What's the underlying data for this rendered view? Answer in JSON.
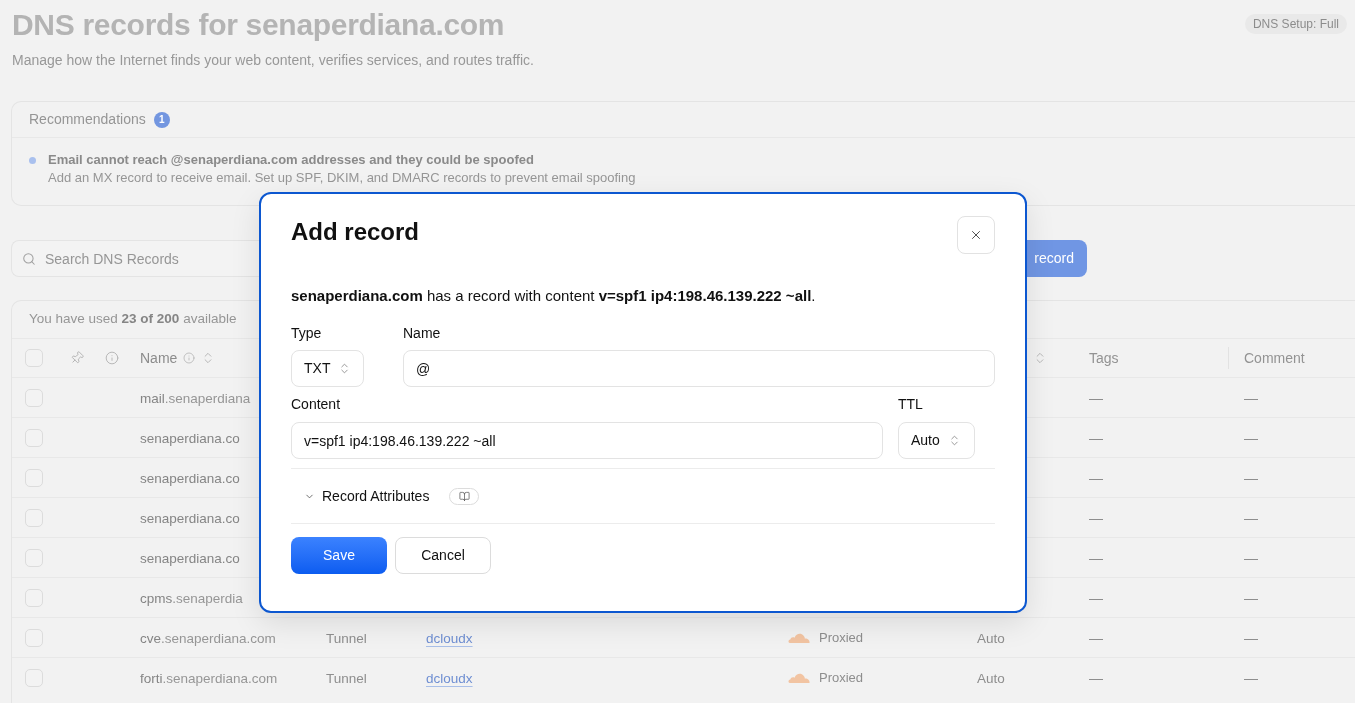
{
  "header": {
    "title": "DNS records for senaperdiana.com",
    "subtitle": "Manage how the Internet finds your web content, verifies services, and routes traffic.",
    "setup_badge": "DNS Setup: Full"
  },
  "recommendations": {
    "title": "Recommendations",
    "count": "1",
    "items": [
      {
        "title": "Email cannot reach @senaperdiana.com addresses and they could be spoofed",
        "description": "Add an MX record to receive email. Set up SPF, DKIM, and DMARC records to prevent email spoofing"
      }
    ]
  },
  "toolbar": {
    "search": {
      "placeholder": "Search DNS Records"
    },
    "add_button": "record"
  },
  "table": {
    "usage": "You have used **23 of 200** available",
    "select_all_checked": false,
    "columns": {
      "name": "Name",
      "tags": "Tags",
      "comment": "Comment"
    },
    "rows": [
      {
        "checked": false,
        "name": {
          "host": "mail",
          "zone": ".senaperdiana"
        },
        "tags": "—",
        "comment": "—"
      },
      {
        "checked": false,
        "name": {
          "host": "senaperdiana.co"
        },
        "tags": "—",
        "comment": "—"
      },
      {
        "checked": false,
        "name": {
          "host": "senaperdiana.co"
        },
        "tags": "—",
        "comment": "—"
      },
      {
        "checked": false,
        "name": {
          "host": "senaperdiana.co"
        },
        "tags": "—",
        "comment": "—"
      },
      {
        "checked": false,
        "name": {
          "host": "senaperdiana.co"
        },
        "tags": "—",
        "comment": "—"
      },
      {
        "checked": false,
        "name": {
          "host": "cpms",
          "zone": ".senaperdia"
        },
        "tags": "—",
        "comment": "—"
      },
      {
        "checked": false,
        "name": {
          "host": "cve",
          "zone": ".senaperdiana.com"
        },
        "type": "Tunnel",
        "content": "dcloudx",
        "proxy_status": "Proxied",
        "ttl": "Auto",
        "tags": "—",
        "comment": "—"
      },
      {
        "checked": false,
        "name": {
          "host": "forti",
          "zone": ".senaperdiana.com"
        },
        "type": "Tunnel",
        "content": "dcloudx",
        "proxy_status": "Proxied",
        "ttl": "Auto",
        "tags": "—",
        "comment": "—"
      }
    ]
  },
  "dialog": {
    "title": "Add record",
    "summary": "**senaperdiana.com** has a record with content **v=spf1 ip4:198.46.139.222 ~all**.",
    "type": {
      "label": "Type",
      "value": "TXT"
    },
    "name": {
      "label": "Name",
      "value": "@"
    },
    "content": {
      "label": "Content",
      "value": "v=spf1 ip4:198.46.139.222 ~all"
    },
    "ttl": {
      "label": "TTL",
      "value": "Auto"
    },
    "attributes": {
      "label": "Record Attributes",
      "expanded": false
    },
    "buttons": [
      {
        "label": "Save",
        "kind": "primary"
      },
      {
        "label": "Cancel",
        "kind": "secondary"
      }
    ]
  }
}
